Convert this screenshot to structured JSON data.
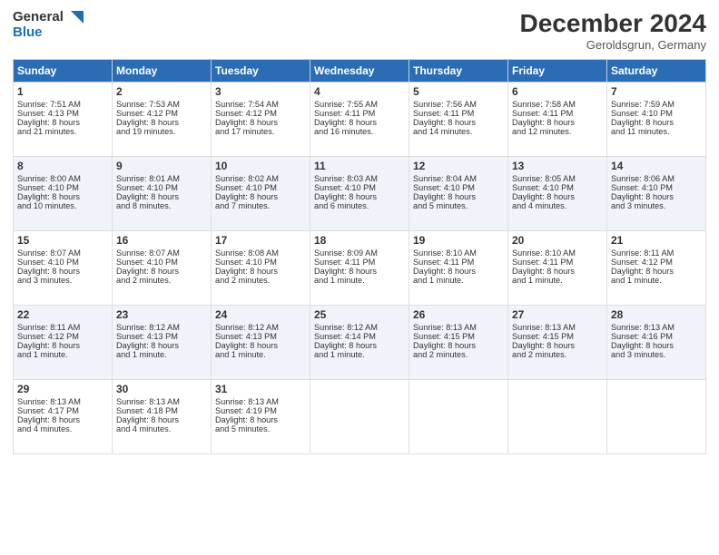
{
  "header": {
    "logo_line1": "General",
    "logo_line2": "Blue",
    "month": "December 2024",
    "location": "Geroldsgrun, Germany"
  },
  "days_of_week": [
    "Sunday",
    "Monday",
    "Tuesday",
    "Wednesday",
    "Thursday",
    "Friday",
    "Saturday"
  ],
  "weeks": [
    [
      {
        "day": "1",
        "lines": [
          "Sunrise: 7:51 AM",
          "Sunset: 4:13 PM",
          "Daylight: 8 hours",
          "and 21 minutes."
        ]
      },
      {
        "day": "2",
        "lines": [
          "Sunrise: 7:53 AM",
          "Sunset: 4:12 PM",
          "Daylight: 8 hours",
          "and 19 minutes."
        ]
      },
      {
        "day": "3",
        "lines": [
          "Sunrise: 7:54 AM",
          "Sunset: 4:12 PM",
          "Daylight: 8 hours",
          "and 17 minutes."
        ]
      },
      {
        "day": "4",
        "lines": [
          "Sunrise: 7:55 AM",
          "Sunset: 4:11 PM",
          "Daylight: 8 hours",
          "and 16 minutes."
        ]
      },
      {
        "day": "5",
        "lines": [
          "Sunrise: 7:56 AM",
          "Sunset: 4:11 PM",
          "Daylight: 8 hours",
          "and 14 minutes."
        ]
      },
      {
        "day": "6",
        "lines": [
          "Sunrise: 7:58 AM",
          "Sunset: 4:11 PM",
          "Daylight: 8 hours",
          "and 12 minutes."
        ]
      },
      {
        "day": "7",
        "lines": [
          "Sunrise: 7:59 AM",
          "Sunset: 4:10 PM",
          "Daylight: 8 hours",
          "and 11 minutes."
        ]
      }
    ],
    [
      {
        "day": "8",
        "lines": [
          "Sunrise: 8:00 AM",
          "Sunset: 4:10 PM",
          "Daylight: 8 hours",
          "and 10 minutes."
        ]
      },
      {
        "day": "9",
        "lines": [
          "Sunrise: 8:01 AM",
          "Sunset: 4:10 PM",
          "Daylight: 8 hours",
          "and 8 minutes."
        ]
      },
      {
        "day": "10",
        "lines": [
          "Sunrise: 8:02 AM",
          "Sunset: 4:10 PM",
          "Daylight: 8 hours",
          "and 7 minutes."
        ]
      },
      {
        "day": "11",
        "lines": [
          "Sunrise: 8:03 AM",
          "Sunset: 4:10 PM",
          "Daylight: 8 hours",
          "and 6 minutes."
        ]
      },
      {
        "day": "12",
        "lines": [
          "Sunrise: 8:04 AM",
          "Sunset: 4:10 PM",
          "Daylight: 8 hours",
          "and 5 minutes."
        ]
      },
      {
        "day": "13",
        "lines": [
          "Sunrise: 8:05 AM",
          "Sunset: 4:10 PM",
          "Daylight: 8 hours",
          "and 4 minutes."
        ]
      },
      {
        "day": "14",
        "lines": [
          "Sunrise: 8:06 AM",
          "Sunset: 4:10 PM",
          "Daylight: 8 hours",
          "and 3 minutes."
        ]
      }
    ],
    [
      {
        "day": "15",
        "lines": [
          "Sunrise: 8:07 AM",
          "Sunset: 4:10 PM",
          "Daylight: 8 hours",
          "and 3 minutes."
        ]
      },
      {
        "day": "16",
        "lines": [
          "Sunrise: 8:07 AM",
          "Sunset: 4:10 PM",
          "Daylight: 8 hours",
          "and 2 minutes."
        ]
      },
      {
        "day": "17",
        "lines": [
          "Sunrise: 8:08 AM",
          "Sunset: 4:10 PM",
          "Daylight: 8 hours",
          "and 2 minutes."
        ]
      },
      {
        "day": "18",
        "lines": [
          "Sunrise: 8:09 AM",
          "Sunset: 4:11 PM",
          "Daylight: 8 hours",
          "and 1 minute."
        ]
      },
      {
        "day": "19",
        "lines": [
          "Sunrise: 8:10 AM",
          "Sunset: 4:11 PM",
          "Daylight: 8 hours",
          "and 1 minute."
        ]
      },
      {
        "day": "20",
        "lines": [
          "Sunrise: 8:10 AM",
          "Sunset: 4:11 PM",
          "Daylight: 8 hours",
          "and 1 minute."
        ]
      },
      {
        "day": "21",
        "lines": [
          "Sunrise: 8:11 AM",
          "Sunset: 4:12 PM",
          "Daylight: 8 hours",
          "and 1 minute."
        ]
      }
    ],
    [
      {
        "day": "22",
        "lines": [
          "Sunrise: 8:11 AM",
          "Sunset: 4:12 PM",
          "Daylight: 8 hours",
          "and 1 minute."
        ]
      },
      {
        "day": "23",
        "lines": [
          "Sunrise: 8:12 AM",
          "Sunset: 4:13 PM",
          "Daylight: 8 hours",
          "and 1 minute."
        ]
      },
      {
        "day": "24",
        "lines": [
          "Sunrise: 8:12 AM",
          "Sunset: 4:13 PM",
          "Daylight: 8 hours",
          "and 1 minute."
        ]
      },
      {
        "day": "25",
        "lines": [
          "Sunrise: 8:12 AM",
          "Sunset: 4:14 PM",
          "Daylight: 8 hours",
          "and 1 minute."
        ]
      },
      {
        "day": "26",
        "lines": [
          "Sunrise: 8:13 AM",
          "Sunset: 4:15 PM",
          "Daylight: 8 hours",
          "and 2 minutes."
        ]
      },
      {
        "day": "27",
        "lines": [
          "Sunrise: 8:13 AM",
          "Sunset: 4:15 PM",
          "Daylight: 8 hours",
          "and 2 minutes."
        ]
      },
      {
        "day": "28",
        "lines": [
          "Sunrise: 8:13 AM",
          "Sunset: 4:16 PM",
          "Daylight: 8 hours",
          "and 3 minutes."
        ]
      }
    ],
    [
      {
        "day": "29",
        "lines": [
          "Sunrise: 8:13 AM",
          "Sunset: 4:17 PM",
          "Daylight: 8 hours",
          "and 4 minutes."
        ]
      },
      {
        "day": "30",
        "lines": [
          "Sunrise: 8:13 AM",
          "Sunset: 4:18 PM",
          "Daylight: 8 hours",
          "and 4 minutes."
        ]
      },
      {
        "day": "31",
        "lines": [
          "Sunrise: 8:13 AM",
          "Sunset: 4:19 PM",
          "Daylight: 8 hours",
          "and 5 minutes."
        ]
      },
      null,
      null,
      null,
      null
    ]
  ]
}
